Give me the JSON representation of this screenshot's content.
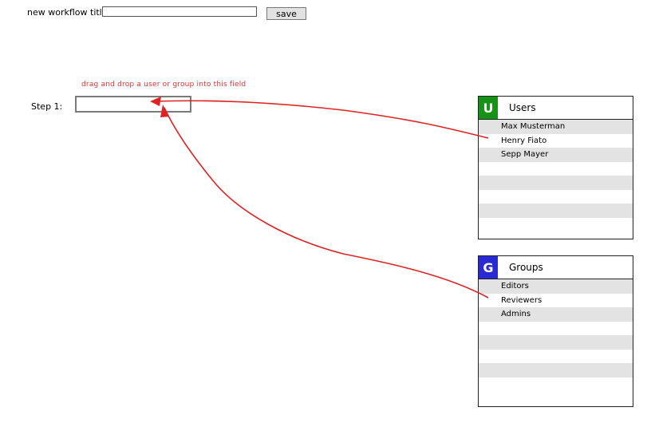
{
  "workflow": {
    "title_label": "new workflow title:",
    "title_value": "",
    "save_label": "save"
  },
  "hint": "drag and drop a user or group into this field",
  "step": {
    "label": "Step 1:"
  },
  "users_panel": {
    "badge": "U",
    "title": "Users",
    "items": [
      "Max Musterman",
      "Henry Fiato",
      "Sepp Mayer",
      "",
      "",
      "",
      "",
      ""
    ]
  },
  "groups_panel": {
    "badge": "G",
    "title": "Groups",
    "items": [
      "Editors",
      "Reviewers",
      "Admins",
      "",
      "",
      "",
      "",
      ""
    ]
  },
  "colors": {
    "arrow": "#e02222",
    "hint": "#e03333",
    "users_badge": "#169216",
    "groups_badge": "#2a2ad4"
  }
}
